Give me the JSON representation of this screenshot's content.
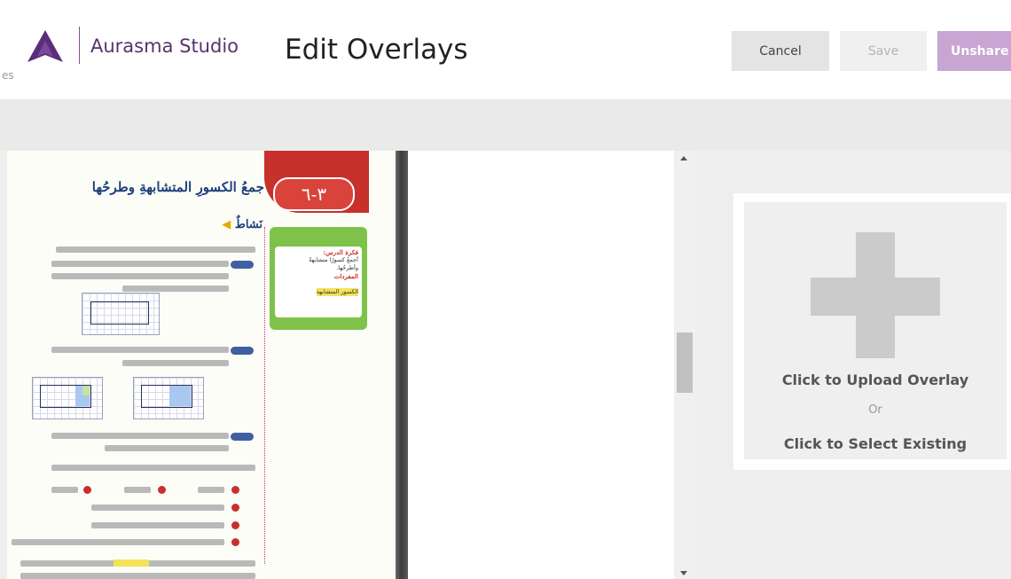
{
  "header": {
    "crumb_fragment": "es",
    "brand": "Aurasma Studio",
    "title": "Edit Overlays",
    "buttons": {
      "cancel": "Cancel",
      "save": "Save",
      "unshare": "Unshare"
    }
  },
  "colors": {
    "brand_purple": "#58336c",
    "logo_purple": "#5b2d7a",
    "unshare_bg": "#c8a5d3",
    "lesson_red": "#c7302b"
  },
  "book": {
    "lesson_number": "٣-٦",
    "lesson_title": "جمعُ الكسورِ المتشابهةِ وطرحُها",
    "section_heading": "نَشاطٌ",
    "card": {
      "title": "فكرة الدرس:",
      "line1": "أجمعُ كسورًا متشابهةً",
      "line2": "وأطرحُها.",
      "vocab_title": "المفردات",
      "vocab_word": "الكسور المتشابهة"
    }
  },
  "overlay": {
    "upload_label": "Click to Upload Overlay",
    "or_label": "Or",
    "select_label": "Click to Select Existing",
    "icon": "plus-icon"
  },
  "scrollbar": {
    "position": 0.55
  }
}
